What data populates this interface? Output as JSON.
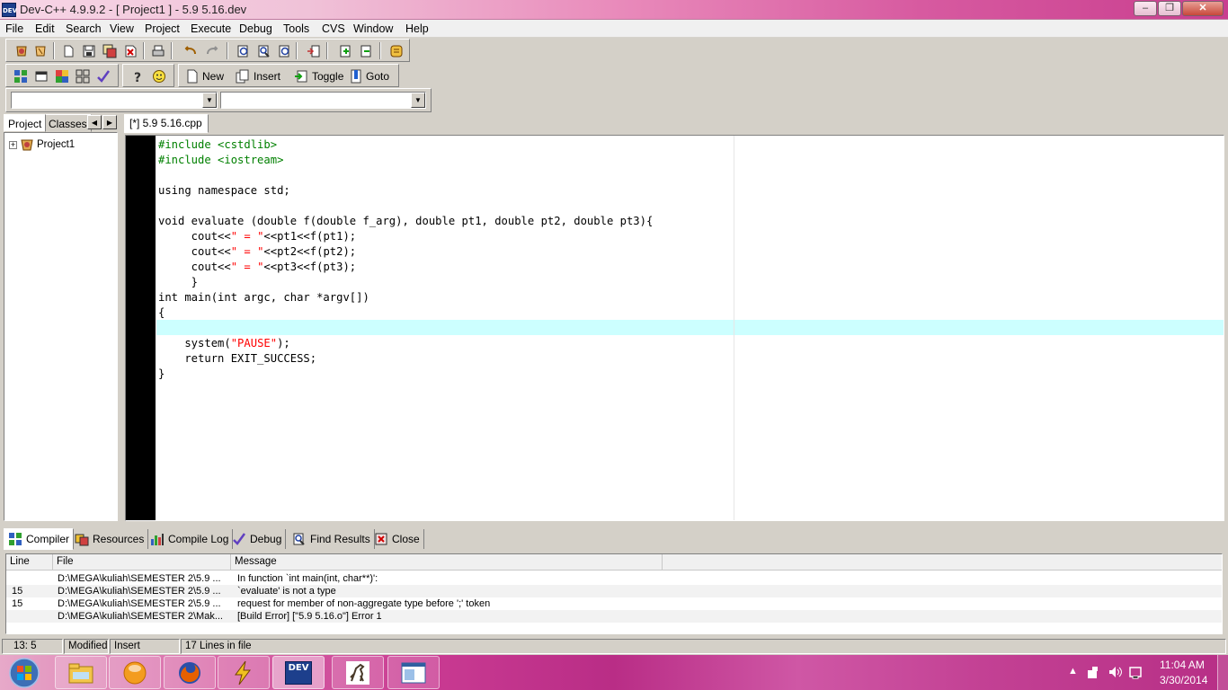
{
  "window": {
    "title": "Dev-C++ 4.9.9.2  -  [ Project1 ] - 5.9 5.16.dev",
    "app_icon_text": "DEV",
    "minimize_glyph": "‒",
    "maximize_glyph": "❐",
    "close_glyph": "✕"
  },
  "menu": [
    "File",
    "Edit",
    "Search",
    "View",
    "Project",
    "Execute",
    "Debug",
    "Tools",
    "CVS",
    "Window",
    "Help"
  ],
  "toolbar2": {
    "new_label": "New",
    "insert_label": "Insert",
    "toggle_label": "Toggle",
    "goto_label": "Goto"
  },
  "combos": {
    "left_value": "",
    "right_value": ""
  },
  "left_panel": {
    "tabs": [
      "Project",
      "Classes"
    ],
    "tree_root": "Project1"
  },
  "editor": {
    "tab_label": "[*] 5.9 5.16.cpp",
    "active_line": 13
  },
  "bottom_tabs": [
    "Compiler",
    "Resources",
    "Compile Log",
    "Debug",
    "Find Results",
    "Close"
  ],
  "compiler": {
    "columns": [
      "Line",
      "File",
      "Message"
    ],
    "rows": [
      {
        "line": "",
        "file": "D:\\MEGA\\kuliah\\SEMESTER 2\\5.9 ...",
        "message": "In function `int main(int, char**)':"
      },
      {
        "line": "15",
        "file": "D:\\MEGA\\kuliah\\SEMESTER 2\\5.9 ...",
        "message": "`evaluate' is not a type"
      },
      {
        "line": "15",
        "file": "D:\\MEGA\\kuliah\\SEMESTER 2\\5.9 ...",
        "message": "request for member of non-aggregate type before ';' token"
      },
      {
        "line": "",
        "file": "D:\\MEGA\\kuliah\\SEMESTER 2\\Mak...",
        "message": "[Build Error]  [\"5.9 5.16.o\"] Error 1"
      }
    ]
  },
  "status": {
    "position": "13: 5",
    "modified": "Modified",
    "mode": "Insert",
    "lines": "17 Lines in file"
  },
  "taskbar": {
    "time": "11:04 AM",
    "date": "3/30/2014",
    "dev_label": "DEV"
  },
  "colors": {
    "title_gradient_end": "#c93e8f",
    "active_line": "#ccffff",
    "preprocessor": "#008000",
    "string": "#ff0000",
    "gutter": "#000000"
  }
}
